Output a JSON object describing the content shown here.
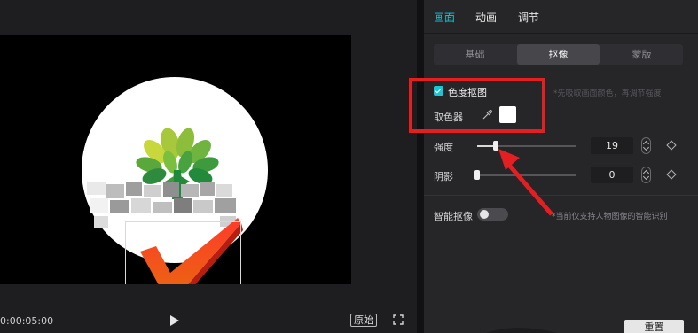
{
  "preview": {
    "timecode": "0:00:05:00",
    "original_label": "原始"
  },
  "panel": {
    "top_tabs": [
      "画面",
      "动画",
      "调节"
    ],
    "sub_tabs": [
      "基础",
      "抠像",
      "蒙版"
    ],
    "chroma_key_label": "色度抠图",
    "chroma_hint": "*先吸取画面颜色，再调节强度",
    "color_picker_label": "取色器",
    "strength_label": "强度",
    "strength_value": "19",
    "strength_level": 0.19,
    "shadow_label": "阴影",
    "shadow_value": "0",
    "shadow_level": 0,
    "smart_keying_label": "智能抠像",
    "smart_keying_hint": "*当前仅支持人物图像的智能识别",
    "reset_label": "重置"
  },
  "colors": {
    "accent": "#19c6d6",
    "annotation_red": "#e51e22"
  }
}
